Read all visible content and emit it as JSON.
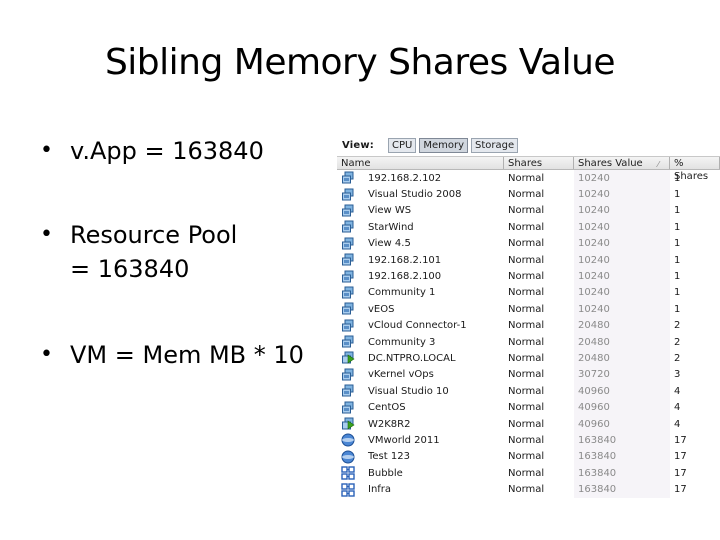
{
  "slide": {
    "title": "Sibling Memory Shares Value",
    "bullets": [
      {
        "lines": [
          "v.App = 163840"
        ]
      },
      {
        "lines": [
          "Resource Pool",
          "= 163840"
        ]
      },
      {
        "lines": [
          "VM = Mem MB * 10"
        ]
      }
    ]
  },
  "screenshot": {
    "view_label": "View:",
    "view_buttons": [
      {
        "label": "CPU",
        "active": false
      },
      {
        "label": "Memory",
        "active": true
      },
      {
        "label": "Storage",
        "active": false
      }
    ],
    "columns": [
      "Name",
      "Shares",
      "Shares Value",
      "% Shares"
    ],
    "sorted_column": "Shares Value",
    "rows": [
      {
        "icon": "vm-icon",
        "name": "192.168.2.102",
        "shares": "Normal",
        "value": "10240",
        "pct": "1"
      },
      {
        "icon": "vm-icon",
        "name": "Visual Studio 2008",
        "shares": "Normal",
        "value": "10240",
        "pct": "1"
      },
      {
        "icon": "vm-icon",
        "name": "View WS",
        "shares": "Normal",
        "value": "10240",
        "pct": "1"
      },
      {
        "icon": "vm-icon",
        "name": "StarWind",
        "shares": "Normal",
        "value": "10240",
        "pct": "1"
      },
      {
        "icon": "vm-icon",
        "name": "View 4.5",
        "shares": "Normal",
        "value": "10240",
        "pct": "1"
      },
      {
        "icon": "vm-icon",
        "name": "192.168.2.101",
        "shares": "Normal",
        "value": "10240",
        "pct": "1"
      },
      {
        "icon": "vm-icon",
        "name": "192.168.2.100",
        "shares": "Normal",
        "value": "10240",
        "pct": "1"
      },
      {
        "icon": "vm-icon",
        "name": "Community 1",
        "shares": "Normal",
        "value": "10240",
        "pct": "1"
      },
      {
        "icon": "vm-icon",
        "name": "vEOS",
        "shares": "Normal",
        "value": "10240",
        "pct": "1"
      },
      {
        "icon": "vm-icon",
        "name": "vCloud Connector-1",
        "shares": "Normal",
        "value": "20480",
        "pct": "2"
      },
      {
        "icon": "vm-icon",
        "name": "Community 3",
        "shares": "Normal",
        "value": "20480",
        "pct": "2"
      },
      {
        "icon": "vm-running-icon",
        "name": "DC.NTPRO.LOCAL",
        "shares": "Normal",
        "value": "20480",
        "pct": "2"
      },
      {
        "icon": "vm-icon",
        "name": "vKernel vOps",
        "shares": "Normal",
        "value": "30720",
        "pct": "3"
      },
      {
        "icon": "vm-icon",
        "name": "Visual Studio 10",
        "shares": "Normal",
        "value": "40960",
        "pct": "4"
      },
      {
        "icon": "vm-icon",
        "name": "CentOS",
        "shares": "Normal",
        "value": "40960",
        "pct": "4"
      },
      {
        "icon": "vm-running-icon",
        "name": "W2K8R2",
        "shares": "Normal",
        "value": "40960",
        "pct": "4"
      },
      {
        "icon": "vapp-icon",
        "name": "VMworld 2011",
        "shares": "Normal",
        "value": "163840",
        "pct": "17"
      },
      {
        "icon": "vapp-icon",
        "name": "Test 123",
        "shares": "Normal",
        "value": "163840",
        "pct": "17"
      },
      {
        "icon": "resource-pool-icon",
        "name": "Bubble",
        "shares": "Normal",
        "value": "163840",
        "pct": "17"
      },
      {
        "icon": "resource-pool-icon",
        "name": "Infra",
        "shares": "Normal",
        "value": "163840",
        "pct": "17"
      }
    ]
  }
}
